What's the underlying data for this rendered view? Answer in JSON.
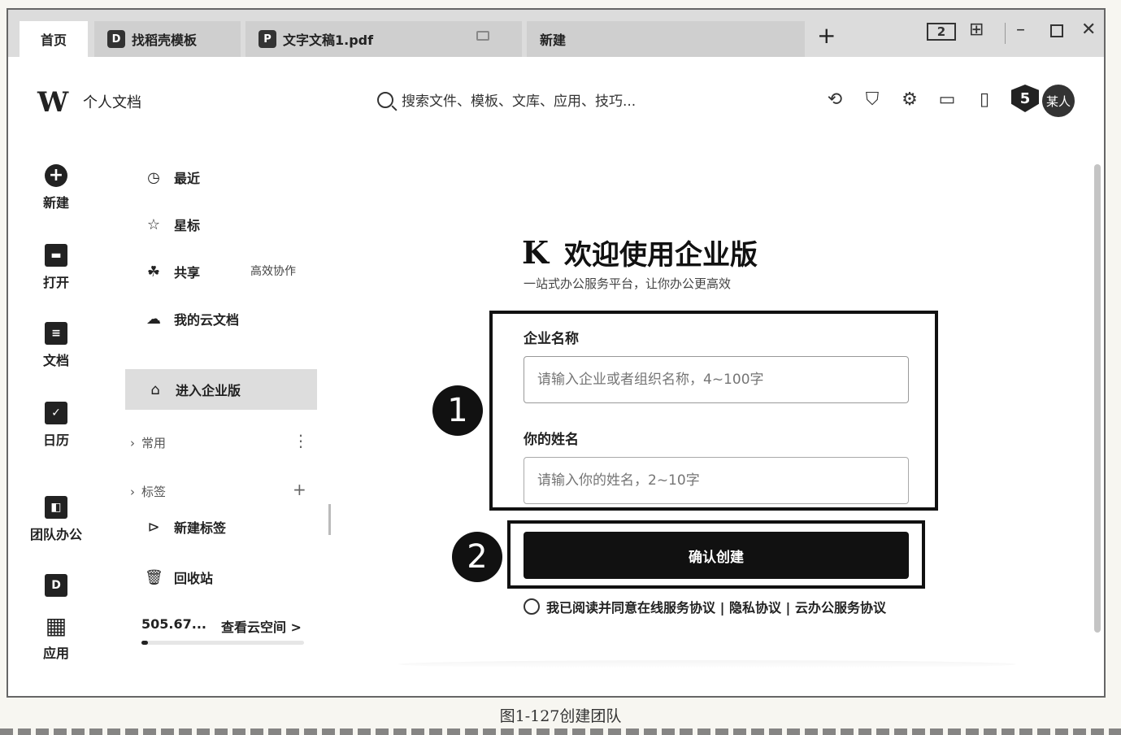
{
  "tabs": [
    {
      "label": "首页"
    },
    {
      "label": "找稻壳模板",
      "icon": "docer-icon"
    },
    {
      "label": "文字文稿1.pdf",
      "icon": "pdf-icon"
    },
    {
      "label": "新建"
    }
  ],
  "window_controls": {
    "layout_label": "2"
  },
  "header": {
    "logo": "W",
    "logo_label": "个人文档",
    "search_placeholder": "搜索文件、模板、文库、应用、技巧..."
  },
  "user": {
    "badge": "5",
    "avatar": "某人"
  },
  "rail": [
    {
      "label": "新建",
      "icon": "plus-circle-icon"
    },
    {
      "label": "打开",
      "icon": "folder-icon"
    },
    {
      "label": "文档",
      "icon": "document-icon"
    },
    {
      "label": "日历",
      "icon": "calendar-icon"
    },
    {
      "label": "团队办公",
      "icon": "team-icon"
    },
    {
      "label": "",
      "icon": "docer-icon"
    },
    {
      "label": "应用",
      "icon": "apps-grid-icon"
    }
  ],
  "nav": {
    "recent": "最近",
    "starred": "星标",
    "shared": "共享",
    "shared_hint": "高效协作",
    "cloud": "我的云文档",
    "enterprise": "进入企业版",
    "common": "常用",
    "tags": "标签",
    "new_tag": "新建标签",
    "recycle": "回收站",
    "storage_used": "505.67...",
    "storage_link": "查看云空间 >",
    "storage_fraction": 0.04
  },
  "main": {
    "logo": "K",
    "title": "欢迎使用企业版",
    "subtitle": "一站式办公服务平台，让你办公更高效",
    "company_label": "企业名称",
    "company_placeholder": "请输入企业或者组织名称，4~100字",
    "name_label": "你的姓名",
    "name_placeholder": "请输入你的姓名，2~10字",
    "confirm": "确认创建",
    "agree": "我已阅读并同意在线服务协议 | 隐私协议 | 云办公服务协议",
    "marker_1": "1",
    "marker_2": "2"
  },
  "caption": "图1-127创建团队"
}
